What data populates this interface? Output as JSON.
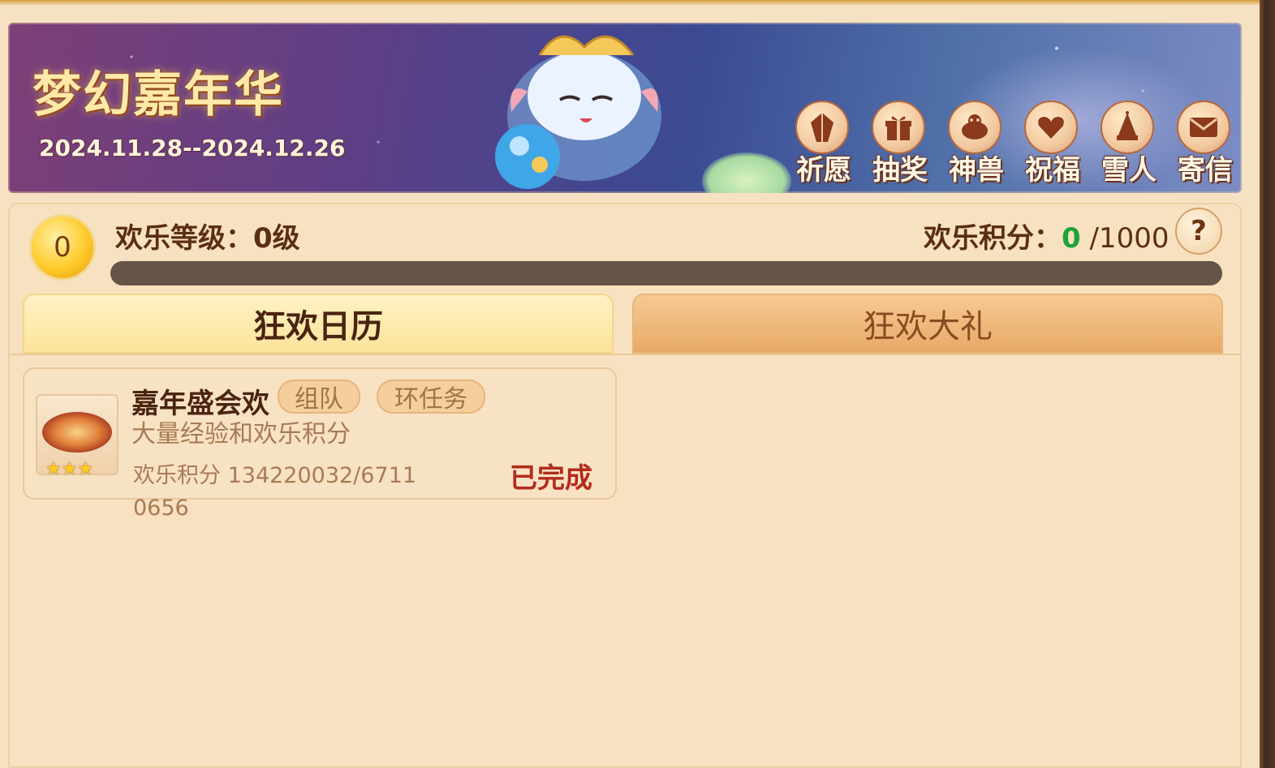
{
  "banner": {
    "title": "梦幻嘉年华",
    "date_range": "2024.11.28--2024.12.26"
  },
  "nav": [
    {
      "label": "祈愿",
      "icon": "crystal-icon"
    },
    {
      "label": "抽奖",
      "icon": "gift-icon"
    },
    {
      "label": "神兽",
      "icon": "beast-icon"
    },
    {
      "label": "祝福",
      "icon": "heart-icon"
    },
    {
      "label": "雪人",
      "icon": "snowman-icon"
    },
    {
      "label": "寄信",
      "icon": "envelope-icon"
    }
  ],
  "status": {
    "level_badge": "0",
    "level_text": "欢乐等级：0级",
    "points_label": "欢乐积分：",
    "points_current": "0",
    "points_max": " /1000",
    "progress": 0,
    "help": "?"
  },
  "tabs": [
    {
      "label": "狂欢日历",
      "active": true
    },
    {
      "label": "狂欢大礼",
      "active": false
    }
  ],
  "task": {
    "title": "嘉年盛会欢",
    "tags": [
      "组队",
      "环任务"
    ],
    "description": "大量经验和欢乐积分",
    "points_text": "欢乐积分 134220032/67110656",
    "stars": "★★★",
    "status": "已完成"
  },
  "colors": {
    "accent_green": "#1fa23a",
    "status_red": "#b22c1c",
    "coin_gold": "#ffcb2c"
  }
}
